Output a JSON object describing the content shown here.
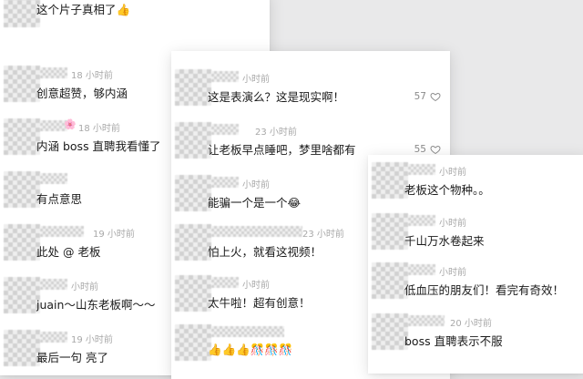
{
  "left_panel": {
    "comments": [
      {
        "time": "",
        "text": "这个片子真相了👍"
      },
      {
        "time": "18 小时前",
        "text": "创意超赞，够内涵"
      },
      {
        "time": "18 小时前",
        "text": "内涵 boss 直聘我看懂了",
        "flower": "🌸"
      },
      {
        "time": "",
        "text": "有点意思"
      },
      {
        "time": "19 小时前",
        "text": "此处 @ 老板"
      },
      {
        "time": "小时前",
        "text": "juain～山东老板啊～～"
      },
      {
        "time": "19 小时前",
        "text": "最后一句 亮了"
      }
    ]
  },
  "middle_panel": {
    "comments": [
      {
        "time": "小时前",
        "text": "这是表演么？这是现实啊！",
        "likes": "57"
      },
      {
        "time": "23 小时前",
        "text": "让老板早点睡吧，梦里啥都有",
        "likes": "55"
      },
      {
        "time": "小时前",
        "text": "能骗一个是一个😂"
      },
      {
        "time": "23 小时前",
        "text": "怕上火，就看这视频！"
      },
      {
        "time": "小时前",
        "text": "太牛啦！超有创意！"
      },
      {
        "time": "",
        "text": "👍👍👍🎊🎊🎊"
      }
    ]
  },
  "right_panel": {
    "comments": [
      {
        "time": "小时前",
        "text": "老板这个物种。。"
      },
      {
        "time": "小时前",
        "text": "千山万水卷起来"
      },
      {
        "time": "小时前",
        "text": "低血压的朋友们！看完有奇效！"
      },
      {
        "time": "20 小时前",
        "text": "boss 直聘表示不服"
      }
    ]
  },
  "icons": {
    "like": "heart-outline-icon"
  },
  "colors": {
    "timestamp": "#a8a8a8",
    "text": "#1a1a1a",
    "likes": "#8a8a8a",
    "card": "#ffffff"
  }
}
